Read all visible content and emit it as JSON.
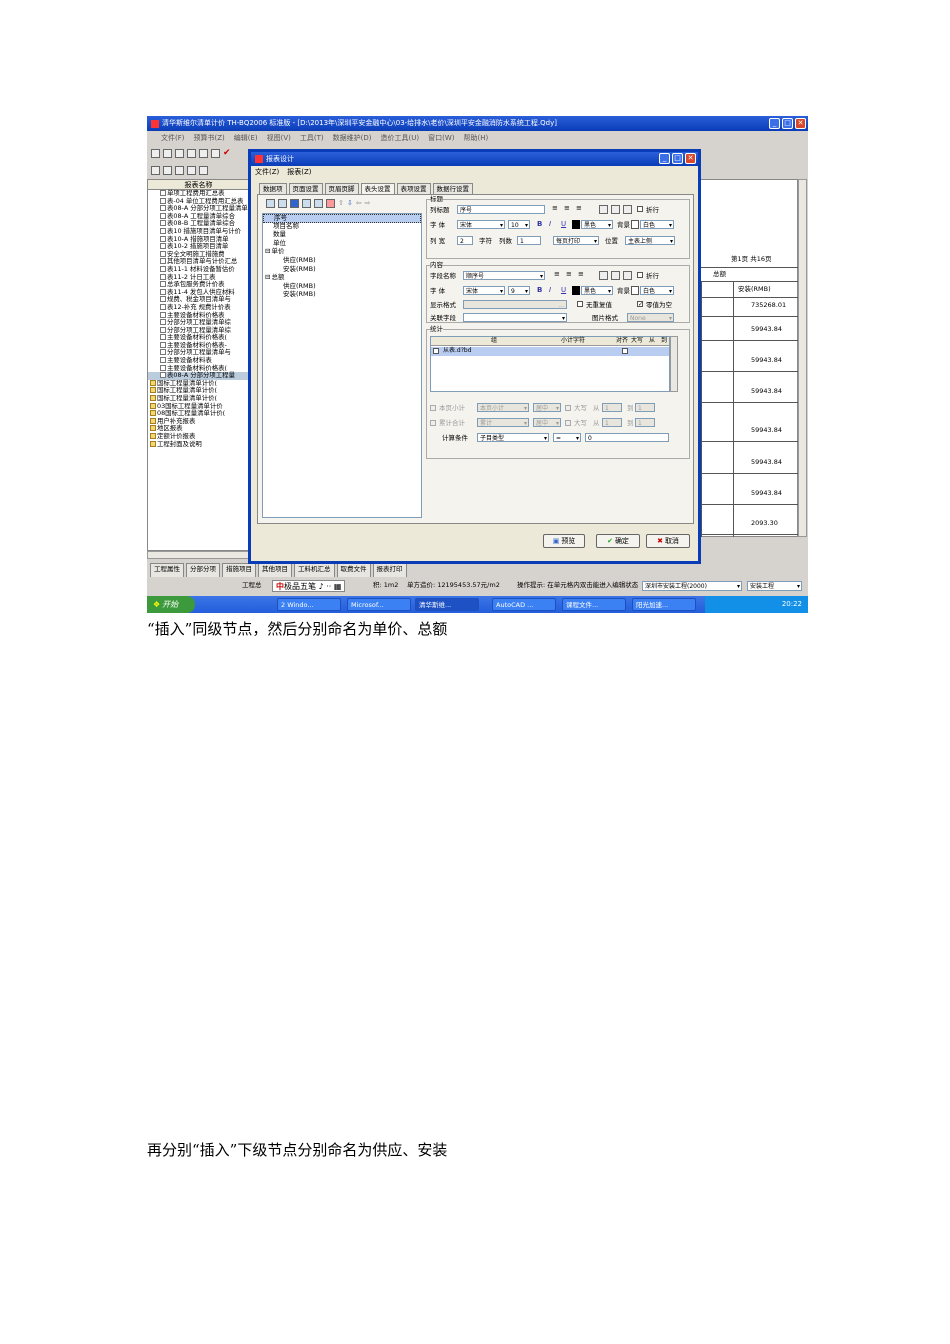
{
  "app": {
    "title": "清华斯维尔清单计价 TH-BQ2006 标准版 - [D:\\2013年\\深圳平安金融中心\\03-给排水\\老价\\深圳平安金融消防水系统工程.Qdy]",
    "menu": [
      "文件(F)",
      "预算书(Z)",
      "编辑(E)",
      "视图(V)",
      "工具(T)",
      "数据维护(D)",
      "造价工具(U)",
      "窗口(W)",
      "帮助(H)"
    ]
  },
  "tree": {
    "header": "报表名称",
    "items": [
      {
        "label": "单项工程费用汇总表",
        "type": "page"
      },
      {
        "label": "表-04 单位工程费用汇总表",
        "type": "page"
      },
      {
        "label": "表08-A 分部分项工程量清单",
        "type": "page"
      },
      {
        "label": "表08-A 工程量清单综合",
        "type": "page"
      },
      {
        "label": "表08-B 工程量清单综合",
        "type": "page"
      },
      {
        "label": "表10 措施项目清单与计价",
        "type": "page"
      },
      {
        "label": "表10-A 措施项目清单",
        "type": "page"
      },
      {
        "label": "表10-2 措施项目清单",
        "type": "page"
      },
      {
        "label": "安全文明施工措施费",
        "type": "page"
      },
      {
        "label": "其他项目清单与计价汇总",
        "type": "page"
      },
      {
        "label": "表11-1 材料设备暂估价",
        "type": "page"
      },
      {
        "label": "表11-2 计日工表",
        "type": "page"
      },
      {
        "label": "总承包服务费计价表",
        "type": "page"
      },
      {
        "label": "表11-4 发包人供应材料",
        "type": "page"
      },
      {
        "label": "规费、税金项目清单与",
        "type": "page"
      },
      {
        "label": "表12-补充 规费计价表",
        "type": "page"
      },
      {
        "label": "主要设备材料价格表",
        "type": "page"
      },
      {
        "label": "分部分项工程量清单综",
        "type": "page"
      },
      {
        "label": "分部分项工程量清单综",
        "type": "page"
      },
      {
        "label": "主要设备材料价格表(",
        "type": "page"
      },
      {
        "label": "主要设备材料价格表-",
        "type": "page"
      },
      {
        "label": "分部分项工程量清单与",
        "type": "page"
      },
      {
        "label": "主要设备材料表",
        "type": "page"
      },
      {
        "label": "主要设备材料价格表(",
        "type": "page"
      },
      {
        "label": "表08-A 分部分项工程量",
        "type": "page",
        "selected": true
      },
      {
        "label": "国标工程量清单计价(",
        "type": "folder"
      },
      {
        "label": "国标工程量清单计价(",
        "type": "folder"
      },
      {
        "label": "国标工程量清单计价(",
        "type": "folder"
      },
      {
        "label": "03国标工程量清单计价",
        "type": "folder"
      },
      {
        "label": "08国标工程量清单计价(",
        "type": "folder"
      },
      {
        "label": "用户补充报表",
        "type": "folder"
      },
      {
        "label": "地区报表",
        "type": "folder"
      },
      {
        "label": "定额计价报表",
        "type": "folder"
      },
      {
        "label": "工程封面及说明",
        "type": "folder"
      }
    ]
  },
  "report_preview": {
    "page_info": "第1页 共16页",
    "col_header": "总额",
    "col_sub_left": ")",
    "col_sub": "安装(RMB)",
    "row_prefix": "4",
    "values": [
      "735268.01",
      "59943.84",
      "59943.84",
      "59943.84",
      "59943.84",
      "59943.84",
      "59943.84",
      "2093.30"
    ]
  },
  "dialog": {
    "title": "报表设计",
    "menu": [
      "文件(Z)",
      "报表(Z)"
    ],
    "tabs": [
      "数据项",
      "页面设置",
      "页眉页脚",
      "表头设置",
      "表项设置",
      "数据行设置"
    ],
    "active_tab": 3,
    "tree": [
      {
        "label": "序号",
        "level": 0,
        "selected": true
      },
      {
        "label": "项目名称",
        "level": 0
      },
      {
        "label": "数量",
        "level": 0
      },
      {
        "label": "单位",
        "level": 0
      },
      {
        "label": "单价",
        "level": 0,
        "group": true
      },
      {
        "label": "供应(RMB)",
        "level": 1
      },
      {
        "label": "安装(RMB)",
        "level": 1
      },
      {
        "label": "总额",
        "level": 0,
        "group": true
      },
      {
        "label": "供应(RMB)",
        "level": 1
      },
      {
        "label": "安装(RMB)",
        "level": 1
      }
    ],
    "title_group": {
      "legend": "标题",
      "col_title_label": "列标题",
      "col_title_value": "序号",
      "wrap_label": "折行",
      "font_label": "字 体",
      "font_name": "宋体",
      "font_size": "10",
      "font_color": "黑色",
      "bg_label": "背景",
      "bg_color": "白色",
      "width_label": "列 宽",
      "width_value": "2",
      "width_unit": "字符",
      "cols_label": "列数",
      "cols_value": "1",
      "print_mode": "每页打印",
      "pos_label": "位置",
      "pos_value": "主表上侧"
    },
    "content_group": {
      "legend": "内容",
      "field_label": "字段名称",
      "field_value": "顺序号",
      "wrap_label": "折行",
      "font_label": "字 体",
      "font_name": "宋体",
      "font_size": "9",
      "font_color": "黑色",
      "bg_label": "背景",
      "bg_color": "白色",
      "display_fmt_label": "显示格式",
      "display_fmt_value": "...",
      "no_zero_label": "无重复值",
      "zero_blank_label": "零值为空",
      "link_field_label": "关联字段",
      "img_fmt_label": "图片格式",
      "img_fmt_value": "None"
    },
    "stats_group": {
      "legend": "统计",
      "headers": [
        "组",
        "小计字符",
        "对齐",
        "大写",
        "从",
        "到"
      ],
      "rows": [
        {
          "group": "从表.d?bd"
        }
      ],
      "page_subtotal_label": "本页小计",
      "page_subtotal_value": "本页小计",
      "page_total_label": "累计合计",
      "page_total_value": "累计",
      "align_value": "居中",
      "upper_label": "大写",
      "from_label": "从",
      "from_value": "1",
      "to_label": "到",
      "to_value": "1",
      "calc_label": "计算条件",
      "calc_field": "子目类型",
      "calc_op": "=",
      "calc_value": "0"
    },
    "buttons": {
      "preview": "预览",
      "ok": "确定",
      "cancel": "取消"
    }
  },
  "bottom_tabs": [
    "工程属性",
    "分部分项",
    "措施项目",
    "其他项目",
    "工料机汇总",
    "取费文件",
    "报表打印"
  ],
  "status": {
    "left": "工程总",
    "ime": "极品五笔",
    "area": "积: 1m2",
    "unit_price": "单方造价: 12195453.57元/m2",
    "hint": "操作提示: 在单元格内双击能进入编辑状态",
    "region": "深圳市安装工程(2000)",
    "type": "安装工程"
  },
  "taskbar": {
    "start": "开始",
    "items": [
      "2 Windo...",
      "Microsof...",
      "清华斯维...",
      "AutoCAD ...",
      "课程文件...",
      "阳光加速..."
    ],
    "clock": "20:22"
  },
  "captions": {
    "first": "“插入”同级节点，然后分别命名为单价、总额",
    "second": "再分别“插入”下级节点分别命名为供应、安装"
  }
}
